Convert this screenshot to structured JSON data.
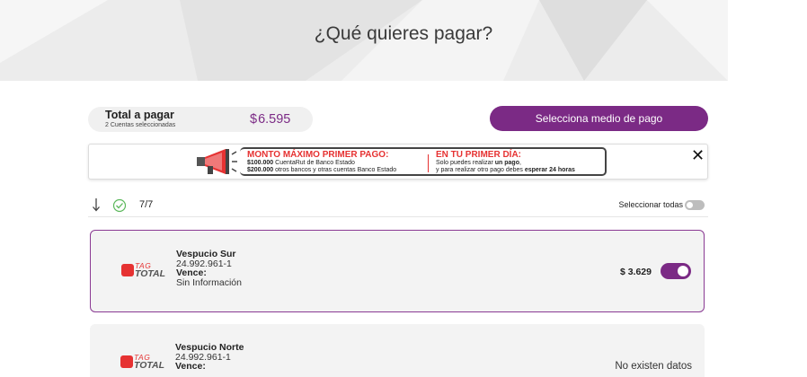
{
  "header": {
    "title": "¿Qué quieres pagar?"
  },
  "summary": {
    "total_label": "Total a pagar",
    "selected_count_text": "2 Cuentas seleccionadas",
    "currency_symbol": "$",
    "total_amount": "6.595",
    "pay_button_label": "Selecciona medio de pago"
  },
  "banner": {
    "left_heading": "MONTO MÁXIMO PRIMER PAGO:",
    "left_line1_amount": "$100.000",
    "left_line1_text": " CuentaRut de Banco Estado",
    "left_line2_amount": "$200.000",
    "left_line2_text": " otros bancos y otras cuentas Banco Estado",
    "right_heading": "EN TU PRIMER DÍA:",
    "right_line1_text": "Solo puedes realizar ",
    "right_line1_bold": "un pago",
    "right_line1_end": ",",
    "right_line2_text": "y para realizar otro pago debes ",
    "right_line2_bold": "esperar 24 horas",
    "close_label": "✕"
  },
  "filters": {
    "count": "7/7",
    "select_all_label": "Seleccionar todas",
    "select_all_on": false
  },
  "accounts": [
    {
      "logo_tag": "TAG",
      "logo_total": "TOTAL",
      "name": "Vespucio Sur",
      "rut": "24.992.961-1",
      "due_label": "Vence:",
      "due_value": "Sin Información",
      "amount": "$ 3.629",
      "selected": true
    },
    {
      "logo_tag": "TAG",
      "logo_total": "TOTAL",
      "name": "Vespucio Norte",
      "rut": "24.992.961-1",
      "due_label": "Vence:",
      "status_text": "No existen datos"
    }
  ],
  "colors": {
    "accent": "#7b2a85",
    "promo_red": "#e63232"
  },
  "icons": [
    "sort-down-icon",
    "check-circle-icon",
    "megaphone-icon",
    "close-icon"
  ]
}
